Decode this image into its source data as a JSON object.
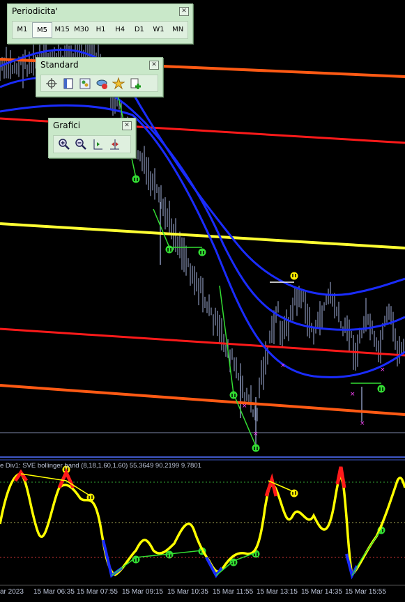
{
  "timeframe_toolbar": {
    "title": "Periodicita'",
    "periods": [
      "M1",
      "M5",
      "M15",
      "M30",
      "H1",
      "H4",
      "D1",
      "W1",
      "MN"
    ],
    "active": "M5"
  },
  "standard_toolbar": {
    "title": "Standard",
    "icons": [
      "crosshair-icon",
      "data-window-icon",
      "navigator-icon",
      "market-watch-icon",
      "favorites-icon",
      "new-order-icon"
    ]
  },
  "charts_toolbar": {
    "title": "Grafici",
    "icons": [
      "zoom-in-icon",
      "zoom-out-icon",
      "chart-shift-icon",
      "auto-scroll-icon"
    ]
  },
  "indicator_label": "e Div1: SVE bollinger band (8,18,1.60,1.60) 55.3649 90.2199 9.7801",
  "time_labels": [
    "ar 2023",
    "15 Mar 06:35",
    "15 Mar 07:55",
    "15 Mar 09:15",
    "15 Mar 10:35",
    "15 Mar 11:55",
    "15 Mar 13:15",
    "15 Mar 14:35",
    "15 Mar 15:55"
  ],
  "colors": {
    "background": "#000000",
    "bollinger": "#1a2cff",
    "red_channel": "#ff1a1a",
    "orange_channel": "#ff5a14",
    "yellow_level": "#ffff33",
    "divergence": "#33dd33",
    "oscillator": "#ffff00"
  }
}
